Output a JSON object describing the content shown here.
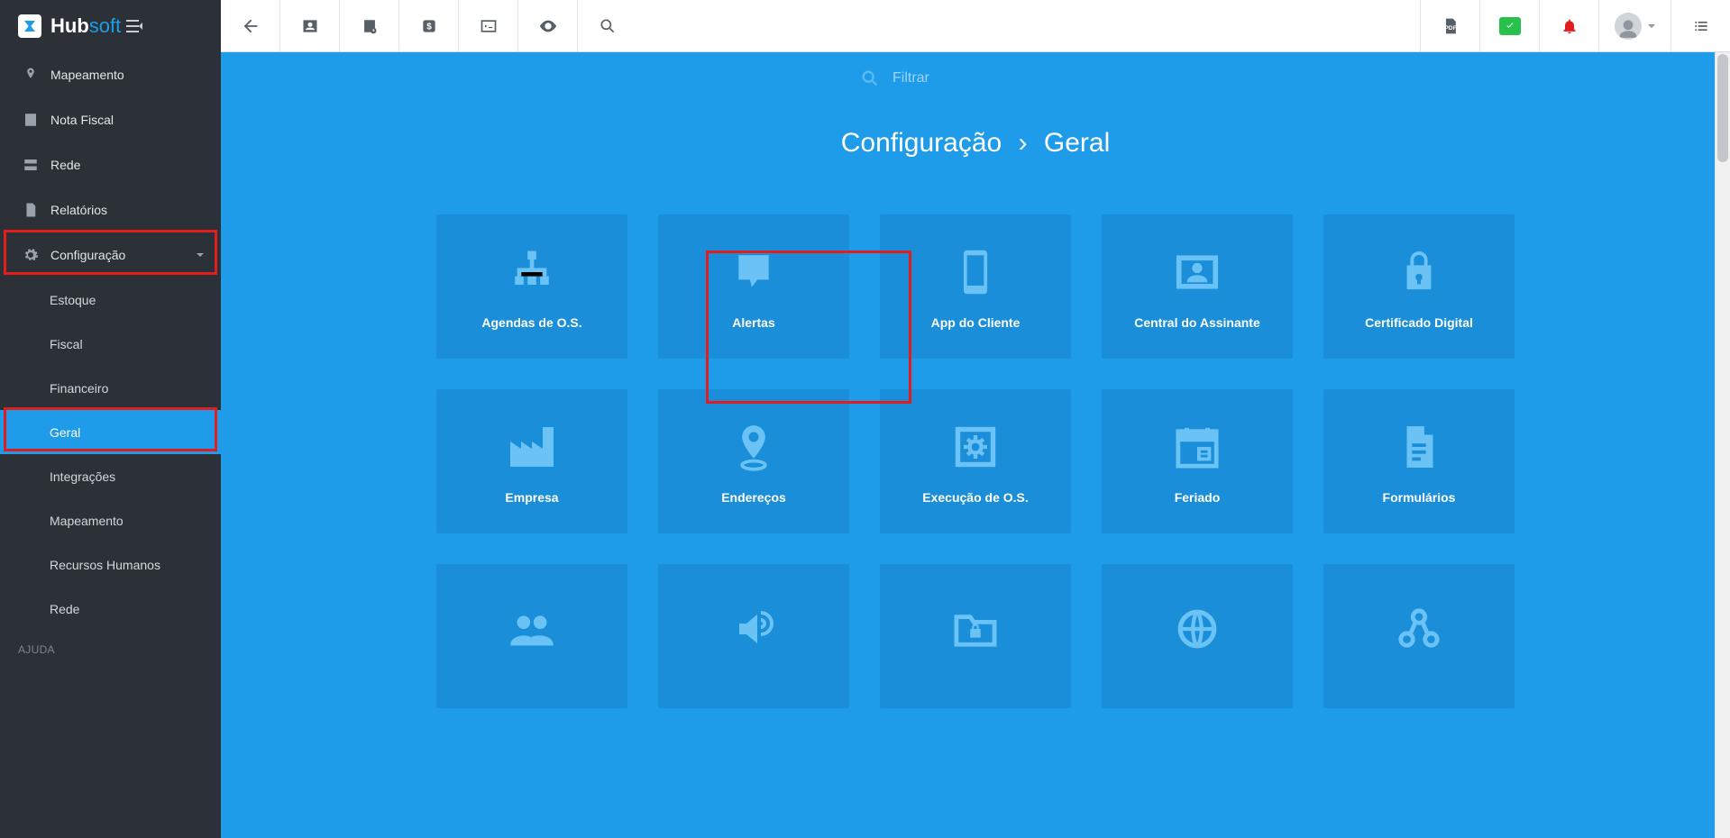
{
  "brand": {
    "part1": "Hub",
    "part2": "soft"
  },
  "sidebar": {
    "items": [
      {
        "label": "Mapeamento",
        "icon": "pin"
      },
      {
        "label": "Nota Fiscal",
        "icon": "doc-lines"
      },
      {
        "label": "Rede",
        "icon": "server"
      },
      {
        "label": "Relatórios",
        "icon": "file"
      },
      {
        "label": "Configuração",
        "icon": "gear",
        "expandable": true
      }
    ],
    "sub": [
      {
        "label": "Estoque"
      },
      {
        "label": "Fiscal"
      },
      {
        "label": "Financeiro"
      },
      {
        "label": "Geral",
        "active": true
      },
      {
        "label": "Integrações"
      },
      {
        "label": "Mapeamento"
      },
      {
        "label": "Recursos Humanos"
      },
      {
        "label": "Rede"
      }
    ],
    "help_label": "AJUDA"
  },
  "search": {
    "placeholder": "Filtrar"
  },
  "breadcrumb": {
    "a": "Configuração",
    "sep": "›",
    "b": "Geral"
  },
  "cards": [
    {
      "label": "Agendas de O.S.",
      "icon": "sitemap"
    },
    {
      "label": "Alertas",
      "icon": "alert"
    },
    {
      "label": "App do Cliente",
      "icon": "phone"
    },
    {
      "label": "Central do Assinante",
      "icon": "id-card"
    },
    {
      "label": "Certificado Digital",
      "icon": "lock"
    },
    {
      "label": "Empresa",
      "icon": "factory"
    },
    {
      "label": "Endereços",
      "icon": "map-pin"
    },
    {
      "label": "Execução de O.S.",
      "icon": "gear-box"
    },
    {
      "label": "Feriado",
      "icon": "calendar"
    },
    {
      "label": "Formulários",
      "icon": "form"
    },
    {
      "label": "",
      "icon": "users"
    },
    {
      "label": "",
      "icon": "volume"
    },
    {
      "label": "",
      "icon": "lock-folder"
    },
    {
      "label": "",
      "icon": "globe"
    },
    {
      "label": "",
      "icon": "nodes"
    }
  ],
  "colors": {
    "accent": "#1e9be9",
    "card": "#1a8ed9",
    "red": "#e11d1d",
    "green": "#27c24c",
    "sidebar": "#2b3137"
  }
}
